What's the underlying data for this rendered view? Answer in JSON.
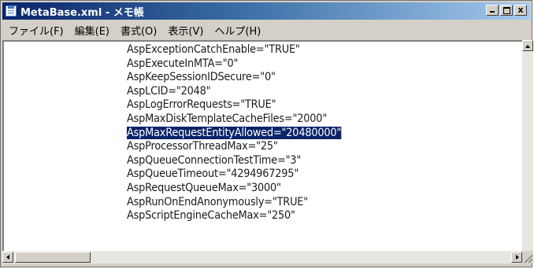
{
  "window": {
    "title": "MetaBase.xml - メモ帳",
    "caption": {
      "minimize": "_",
      "maximize": "",
      "close": "x"
    }
  },
  "menu": [
    "ファイル(F)",
    "編集(E)",
    "書式(O)",
    "表示(V)",
    "ヘルプ(H)"
  ],
  "editor": {
    "lines": [
      "AspExceptionCatchEnable=\"TRUE\"",
      "AspExecuteInMTA=\"0\"",
      "AspKeepSessionIDSecure=\"0\"",
      "AspLCID=\"2048\"",
      "AspLogErrorRequests=\"TRUE\"",
      "AspMaxDiskTemplateCacheFiles=\"2000\"",
      "AspMaxRequestEntityAllowed=\"20480000\"",
      "AspProcessorThreadMax=\"25\"",
      "AspQueueConnectionTestTime=\"3\"",
      "AspQueueTimeout=\"4294967295\"",
      "AspRequestQueueMax=\"3000\"",
      "AspRunOnEndAnonymously=\"TRUE\"",
      "AspScriptEngineCacheMax=\"250\""
    ],
    "selected_line_index": 6
  },
  "colors": {
    "title_gradient_start": "#0a246a",
    "title_gradient_end": "#a6caf0",
    "selection": "#0a246a",
    "chrome": "#d4d0c8"
  },
  "icons": {
    "app": "notepad-icon",
    "minimize": "minimize-icon",
    "maximize": "maximize-icon",
    "close": "close-icon"
  }
}
